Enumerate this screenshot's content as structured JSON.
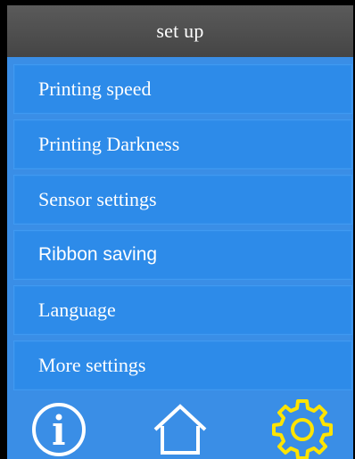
{
  "header": {
    "title": "set up"
  },
  "menu": {
    "items": [
      {
        "label": "Printing speed"
      },
      {
        "label": "Printing Darkness"
      },
      {
        "label": "Sensor settings"
      },
      {
        "label": "Ribbon saving"
      },
      {
        "label": "Language"
      },
      {
        "label": "More settings"
      }
    ]
  },
  "bottom_nav": {
    "icons": [
      "info-icon",
      "home-icon",
      "gear-icon"
    ]
  },
  "colors": {
    "background": "#3a8ee6",
    "item": "#2d8be9",
    "titlebar": "#4f4f4f",
    "active_icon": "#ffe400",
    "icon": "#ffffff"
  }
}
